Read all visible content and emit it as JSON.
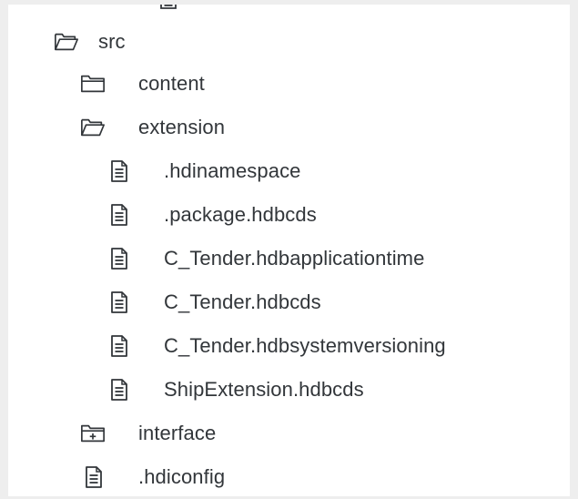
{
  "tree": {
    "items": [
      {
        "name": "src",
        "type": "folder-open",
        "icon": "folder-open-icon"
      },
      {
        "name": "content",
        "type": "folder",
        "icon": "folder-icon"
      },
      {
        "name": "extension",
        "type": "folder-open",
        "icon": "folder-open-icon"
      },
      {
        "name": ".hdinamespace",
        "type": "file",
        "icon": "document-icon"
      },
      {
        "name": ".package.hdbcds",
        "type": "file",
        "icon": "document-icon"
      },
      {
        "name": "C_Tender.hdbapplicationtime",
        "type": "file",
        "icon": "document-icon"
      },
      {
        "name": "C_Tender.hdbcds",
        "type": "file",
        "icon": "document-icon"
      },
      {
        "name": "C_Tender.hdbsystemversioning",
        "type": "file",
        "icon": "document-icon"
      },
      {
        "name": "ShipExtension.hdbcds",
        "type": "file",
        "icon": "document-icon"
      },
      {
        "name": "interface",
        "type": "folder-collapsed",
        "icon": "folder-plus-icon"
      },
      {
        "name": ".hdiconfig",
        "type": "file",
        "icon": "document-icon"
      }
    ]
  },
  "colors": {
    "icon": "#32363a",
    "text": "#32363a",
    "background": "#ffffff",
    "frame": "#eeeeee"
  }
}
